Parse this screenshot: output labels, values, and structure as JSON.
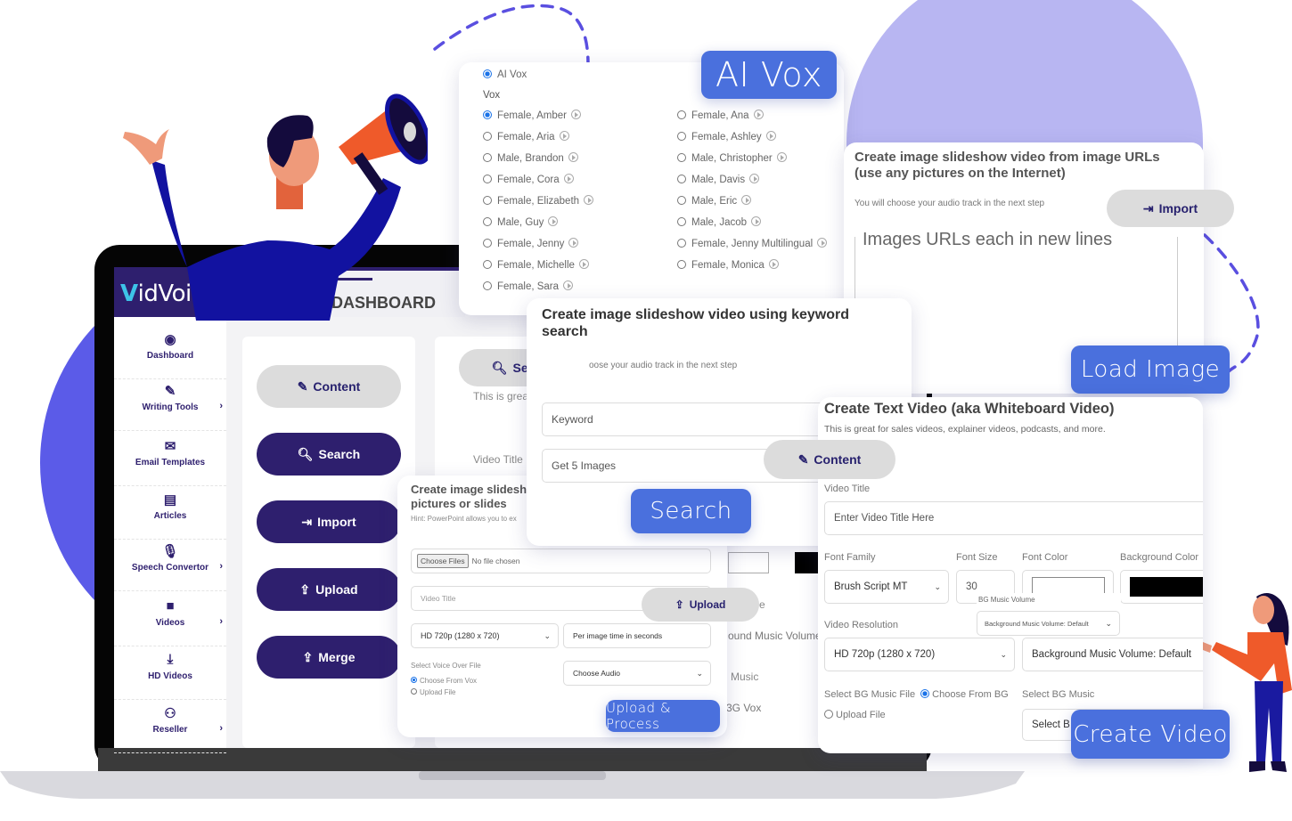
{
  "colors": {
    "accent_blue": "#4a70dd",
    "brand_dark": "#2e1f6e",
    "circle_purple": "#5b5be8",
    "circle_light": "#b8b6f2",
    "dash_line": "#5a4fe0"
  },
  "app": {
    "logo_text": "idVoicer",
    "logo_prefix_glyph": "V",
    "header_title": "DASHBOARD"
  },
  "sidebar": {
    "items": [
      {
        "label": "Dashboard",
        "icon": "gauge-icon",
        "glyph": "◉",
        "has_arrow": false
      },
      {
        "label": "Writing Tools",
        "icon": "pencil-icon",
        "glyph": "✎",
        "has_arrow": true
      },
      {
        "label": "Email Templates",
        "icon": "envelope-icon",
        "glyph": "✉",
        "has_arrow": false
      },
      {
        "label": "Articles",
        "icon": "newspaper-icon",
        "glyph": "▤",
        "has_arrow": false
      },
      {
        "label": "Speech Convertor",
        "icon": "microphone-icon",
        "glyph": "🎙",
        "has_arrow": true
      },
      {
        "label": "Videos",
        "icon": "video-camera-icon",
        "glyph": "■",
        "has_arrow": true
      },
      {
        "label": "HD Videos",
        "icon": "download-icon",
        "glyph": "⤓",
        "has_arrow": false
      },
      {
        "label": "Reseller",
        "icon": "users-icon",
        "glyph": "⚇",
        "has_arrow": true
      }
    ],
    "arrow_glyph": "›"
  },
  "action_buttons": {
    "content": "Content",
    "search": "Search",
    "import": "Import",
    "upload": "Upload",
    "merge": "Merge"
  },
  "bg_panel": {
    "search_button": "Search",
    "desc_partial": "This is grea",
    "video_title_label": "Video Title",
    "audio_hint_partial": "oose your audio track in the next step",
    "partial_label_e": "e",
    "partial_bg_music_volume": "ound Music Volume",
    "partial_music": "Music",
    "partial_bg_vox": "3G Vox"
  },
  "ai_vox_panel": {
    "tag": "AI Vox",
    "ai_vox_option": "AI Vox",
    "section_label": "Vox",
    "voices_left": [
      {
        "label": "Female, Amber",
        "selected": true
      },
      {
        "label": "Female, Aria",
        "selected": false
      },
      {
        "label": "Male, Brandon",
        "selected": false
      },
      {
        "label": "Female, Cora",
        "selected": false
      },
      {
        "label": "Female, Elizabeth",
        "selected": false
      },
      {
        "label": "Male, Guy",
        "selected": false
      },
      {
        "label": "Female, Jenny",
        "selected": false
      },
      {
        "label": "Female, Michelle",
        "selected": false
      },
      {
        "label": "Female, Sara",
        "selected": false
      }
    ],
    "voices_right": [
      {
        "label": "Female, Ana",
        "selected": false
      },
      {
        "label": "Female, Ashley",
        "selected": false
      },
      {
        "label": "Male, Christopher",
        "selected": false
      },
      {
        "label": "Male, Davis",
        "selected": false
      },
      {
        "label": "Male, Eric",
        "selected": false
      },
      {
        "label": "Male, Jacob",
        "selected": false
      },
      {
        "label": "Female, Jenny Multilingual",
        "selected": false
      },
      {
        "label": "Female, Monica",
        "selected": false
      }
    ]
  },
  "url_panel": {
    "title_line1": "Create image slideshow video from image URLs",
    "title_line2": "(use any pictures on the Internet)",
    "hint": "You will choose your audio track in the next step",
    "import_button": "Import",
    "textarea_placeholder": "Images URLs each in new lines",
    "tag": "Load Image"
  },
  "keyword_panel": {
    "title_line1": "Create image slideshow video using keyword",
    "title_line2": "search",
    "keyword_placeholder": "Keyword",
    "count_select": "Get 5 Images",
    "search_tag": "Search"
  },
  "upload_panel": {
    "title_line1": "Create image slidesh",
    "title_line2": "pictures or slides",
    "hint": "Hint: PowerPoint allows you to ex",
    "choose_files_button": "Choose Files",
    "no_file": "No file chosen",
    "video_title_placeholder": "Video Title",
    "resolution_select": "HD 720p (1280 x 720)",
    "per_image_placeholder": "Per image time in seconds",
    "voice_label": "Select Voice Over File",
    "voice_opt_vox": "Choose From Vox",
    "voice_opt_upload": "Upload File",
    "audio_select": "Choose Audio",
    "upload_pill": "Upload",
    "process_tag": "Upload & Process"
  },
  "text_video_panel": {
    "title": "Create Text Video (aka Whiteboard Video)",
    "desc": "This is great for sales videos, explainer videos, podcasts, and more.",
    "content_pill": "Content",
    "video_title_label": "Video Title",
    "video_title_placeholder": "Enter Video Title Here",
    "font_family_label": "Font Family",
    "font_family_value": "Brush Script MT",
    "font_size_label": "Font Size",
    "font_size_value": "30",
    "font_color_label": "Font Color",
    "font_color_value": "#ffffff",
    "bg_color_label": "Background Color",
    "bg_color_value": "#000000",
    "bg_music_volume_label": "BG Music Volume",
    "bg_music_volume_popup": "Background Music Volume: Default",
    "resolution_label": "Video Resolution",
    "resolution_value": "HD 720p (1280 x 720)",
    "bg_music_volume_value": "Background Music Volume: Default",
    "bg_music_file_label": "Select BG Music File",
    "bg_opt_choose": "Choose From BG",
    "bg_opt_upload": "Upload File",
    "bg_music_label": "Select BG Music",
    "bg_music_select_partial": "Select B",
    "tag": "Create Video"
  }
}
